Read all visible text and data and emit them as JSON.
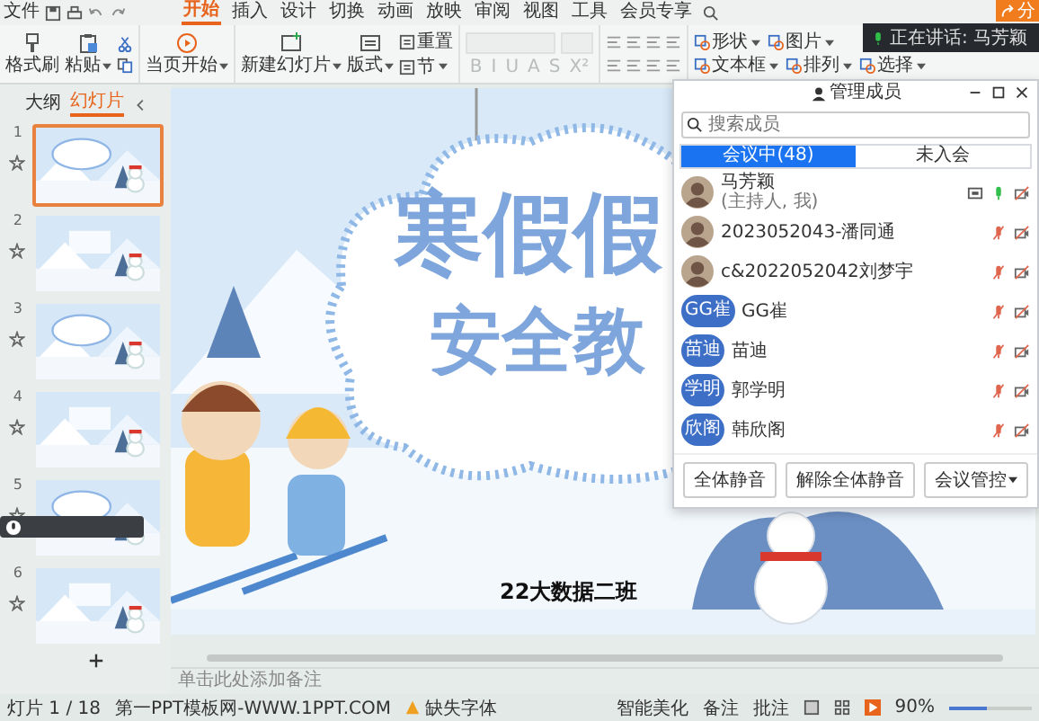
{
  "menu": {
    "file": "文件",
    "tabs": [
      {
        "label": "开始",
        "selected": true
      },
      {
        "label": "插入",
        "selected": false
      },
      {
        "label": "设计",
        "selected": false
      },
      {
        "label": "切换",
        "selected": false
      },
      {
        "label": "动画",
        "selected": false
      },
      {
        "label": "放映",
        "selected": false
      },
      {
        "label": "审阅",
        "selected": false
      },
      {
        "label": "视图",
        "selected": false
      },
      {
        "label": "工具",
        "selected": false
      },
      {
        "label": "会员专享",
        "selected": false
      }
    ],
    "share_button": "分"
  },
  "speaking_toast": {
    "label": "正在讲话:",
    "name": "马芳颖"
  },
  "ribbon": {
    "clipboard": [
      {
        "label": "格式刷",
        "menu": false
      },
      {
        "label": "粘贴",
        "menu": true
      }
    ],
    "play": {
      "label": "当页开始",
      "menu": true
    },
    "slides": [
      {
        "label": "新建幻灯片",
        "menu": true
      },
      {
        "label": "版式",
        "menu": true
      }
    ],
    "slide_small": [
      {
        "label": "重置",
        "menu": false
      },
      {
        "label": "节",
        "menu": true
      }
    ],
    "font": {
      "disabled": true,
      "format": [
        "B",
        "I",
        "U",
        "A",
        "S",
        "X²"
      ]
    },
    "drawing": [
      {
        "label": "形状",
        "menu": true
      },
      {
        "label": "图片",
        "menu": true
      },
      {
        "label": "文本框",
        "menu": true
      },
      {
        "label": "排列",
        "menu": true
      },
      {
        "label": "选择",
        "menu": true
      }
    ]
  },
  "sidebar": {
    "tabs": [
      {
        "label": "大纲",
        "selected": false
      },
      {
        "label": "幻灯片",
        "selected": true
      }
    ],
    "thumbnails": [
      {
        "number": "1",
        "selected": true
      },
      {
        "number": "2",
        "selected": false
      },
      {
        "number": "3",
        "selected": false
      },
      {
        "number": "4",
        "selected": false
      },
      {
        "number": "5",
        "selected": false
      },
      {
        "number": "6",
        "selected": false
      }
    ]
  },
  "slide": {
    "title_line1": "寒假假",
    "title_line2": "安全教",
    "subtitle": "22大数据二班"
  },
  "notes": {
    "placeholder": "单击此处添加备注"
  },
  "members_panel": {
    "title": "管理成员",
    "search": {
      "placeholder": "搜索成员"
    },
    "tabs": [
      {
        "label": "会议中(48)",
        "selected": true
      },
      {
        "label": "未入会",
        "selected": false
      }
    ],
    "members": [
      {
        "name": "马芳颖",
        "note": "(主持人, 我)",
        "host": true,
        "muted": false
      },
      {
        "name": "2023052043-潘同通",
        "host": false,
        "muted": true
      },
      {
        "name": "c&2022052042刘梦宇",
        "host": false,
        "muted": true
      },
      {
        "name": "GG崔",
        "avatar": {
          "kind": "text",
          "text": "GG崔"
        },
        "host": false,
        "muted": true
      },
      {
        "name": "苗迪",
        "avatar": {
          "kind": "text",
          "text": "苗迪"
        },
        "host": false,
        "muted": true
      },
      {
        "name": "郭学明",
        "avatar": {
          "kind": "text",
          "text": "学明"
        },
        "host": false,
        "muted": true
      },
      {
        "name": "韩欣阁",
        "avatar": {
          "kind": "text",
          "text": "欣阁"
        },
        "host": false,
        "muted": true
      }
    ],
    "buttons": [
      {
        "label": "全体静音",
        "menu": false
      },
      {
        "label": "解除全体静音",
        "menu": false
      },
      {
        "label": "会议管控",
        "menu": true
      }
    ]
  },
  "status_bar": {
    "slide_count": "灯片 1 / 18",
    "template": "第一PPT模板网-WWW.1PPT.COM",
    "missing_fonts": "缺失字体",
    "beautify": "智能美化",
    "notes": "备注",
    "comments": "批注",
    "zoom": "90%",
    "zoom_slider": {
      "level": 0.45
    }
  }
}
